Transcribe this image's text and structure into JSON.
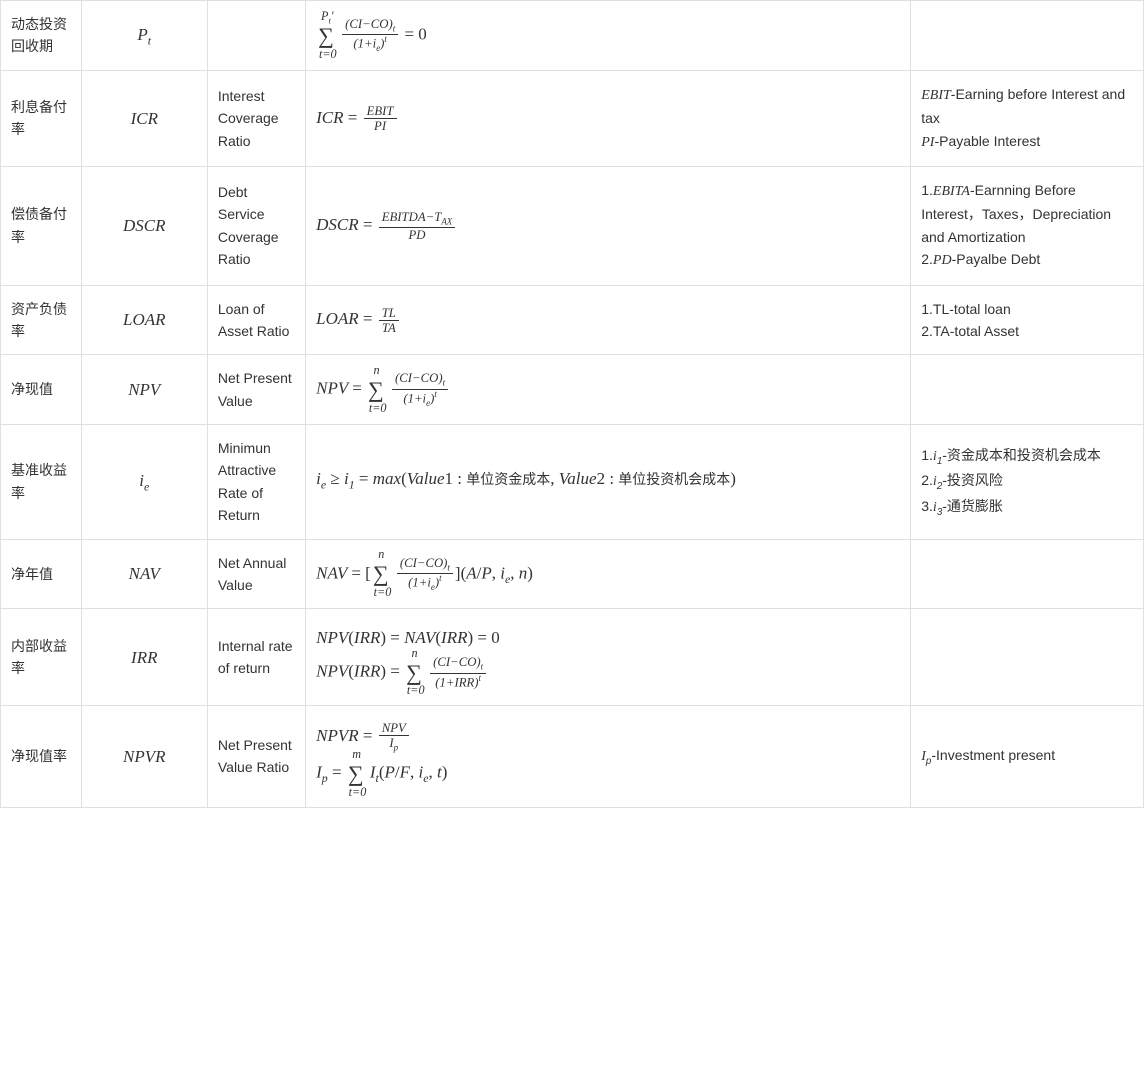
{
  "rows": [
    {
      "name": "动态投资回收期",
      "symbol_html": "<span class='mi'>P</span><span class='sub'>t</span>",
      "english": "",
      "formula_html": "<span class='bigop'>∑<span class='limits-top'>P<span class=\"sub\">t</span>′</span><span class='limits-bot'>t=0</span></span>&nbsp;<span class='frac'><span class='num'>(CI−CO)<span class=\"sub\">t</span></span><span class='den'>(1+i<span class=\"sub\">e</span>)<span class=\"sup\">t</span></span></span> <span class='mn'>= 0</span>",
      "note_html": ""
    },
    {
      "name": "利息备付率",
      "symbol_html": "<span class='mi'>ICR</span>",
      "english": "Interest Coverage Ratio",
      "formula_html": "<span class='mi'>ICR</span> <span class='mn'>=</span> <span class='frac'><span class='num'>EBIT</span><span class='den'>PI</span></span>",
      "note_html": "<span class='mi'>EBIT</span>-Earning before Interest and tax<br><span class='mi'>PI</span>-Payable Interest"
    },
    {
      "name": "偿债备付率",
      "symbol_html": "<span class='mi'>DSCR</span>",
      "english": "Debt Service Coverage Ratio",
      "formula_html": "<span class='mi'>DSCR</span> <span class='mn'>=</span> <span class='frac'><span class='num'>EBITDA−T<span class=\"sub\">AX</span></span><span class='den'>PD</span></span>",
      "note_html": "1.<span class='mi'>EBITA</span>-Earnning Before Interest，Taxes，Depreciation and Amortization<br>2.<span class='mi'>PD</span>-Payalbe Debt"
    },
    {
      "name": "资产负债率",
      "symbol_html": "<span class='mi'>LOAR</span>",
      "english": "Loan of Asset Ratio",
      "formula_html": "<span class='mi'>LOAR</span> <span class='mn'>=</span> <span class='frac'><span class='num'>TL</span><span class='den'>TA</span></span>",
      "note_html": "1.TL-total loan<br>2.TA-total Asset"
    },
    {
      "name": "净现值",
      "symbol_html": "<span class='mi'>NPV</span>",
      "english": "Net Present Value",
      "formula_html": "<span class='mi'>NPV</span> <span class='mn'>=</span> <span class='bigop'>∑<span class='limits-top'>n</span><span class='limits-bot'>t=0</span></span>&nbsp;<span class='frac'><span class='num'>(CI−CO)<span class=\"sub\">t</span></span><span class='den'>(1+i<span class=\"sub\">e</span>)<span class=\"sup\">t</span></span></span>",
      "note_html": ""
    },
    {
      "name": "基准收益率",
      "symbol_html": "<span class='mi'>i</span><span class='sub'>e</span>",
      "english": "Minimun Attractive Rate of Return",
      "formula_html": "<span class='mi'>i</span><span class='sub'>e</span> <span class='mn'>≥</span> <span class='mi'>i</span><span class='sub'>1</span> <span class='mn'>=</span> <span class='mi'>max</span><span class='mn'>(</span><span class='mi'>Value</span><span class='mn'>1 : </span><span class='mtext'>单位资金成本</span><span class='mn'>, </span><span class='mi'>Value</span><span class='mn'>2 : </span><span class='mtext'>单位投资机会成本</span><span class='mn'>)</span>&nbsp;&nbsp;&nbsp;&nbsp;&nbsp;&nbsp;&nbsp;&nbsp;",
      "formula_scroll": true,
      "note_html": "1.<span class='mi'>i</span><span class='sub'>1</span>-资金成本和投资机会成本<br>2.<span class='mi'>i</span><span class='sub'>2</span>-投资风险<br>3.<span class='mi'>i</span><span class='sub'>3</span>-通货膨胀"
    },
    {
      "name": "净年值",
      "symbol_html": "<span class='mi'>NAV</span>",
      "english": "Net Annual Value",
      "formula_html": "<span class='mi'>NAV</span> <span class='mn'>= [</span><span class='bigop'>∑<span class='limits-top'>n</span><span class='limits-bot'>t=0</span></span>&nbsp;<span class='frac'><span class='num'>(CI−CO)<span class=\"sub\">t</span></span><span class='den'>(1+i<span class=\"sub\">e</span>)<span class=\"sup\">t</span></span></span><span class='mn'>](</span><span class='mi'>A</span><span class='mn'>/</span><span class='mi'>P</span><span class='mn'>, </span><span class='mi'>i</span><span class='sub'>e</span><span class='mn'>, </span><span class='mi'>n</span><span class='mn'>)</span>",
      "note_html": ""
    },
    {
      "name": "内部收益率",
      "symbol_html": "<span class='mi'>IRR</span>",
      "english": "Internal rate of return",
      "formula_html": "<span class='mline'><span class='mi'>NPV</span><span class='mn'>(</span><span class='mi'>IRR</span><span class='mn'>) = </span><span class='mi'>NAV</span><span class='mn'>(</span><span class='mi'>IRR</span><span class='mn'>) = 0</span></span><span class='mline'><span class='mi'>NPV</span><span class='mn'>(</span><span class='mi'>IRR</span><span class='mn'>) = </span><span class='bigop'>∑<span class='limits-top'>n</span><span class='limits-bot'>t=0</span></span>&nbsp;<span class='frac'><span class='num'>(CI−CO)<span class=\"sub\">t</span></span><span class='den'>(1+IRR)<span class=\"sup\">t</span></span></span></span>",
      "note_html": ""
    },
    {
      "name": "净现值率",
      "symbol_html": "<span class='mi'>NPVR</span>",
      "english": "Net Present Value Ratio",
      "formula_html": "<span class='mline'><span class='mi'>NPVR</span> <span class='mn'>=</span> <span class='frac'><span class='num'>NPV</span><span class='den'>I<span class=\"sub\">p</span></span></span></span><span class='mline'><span class='mi'>I</span><span class='sub'>p</span> <span class='mn'>=</span> <span class='bigop'>∑<span class='limits-top'>m</span><span class='limits-bot'>t=0</span></span>&nbsp;<span class='mi'>I</span><span class='sub'>t</span><span class='mn'>(</span><span class='mi'>P</span><span class='mn'>/</span><span class='mi'>F</span><span class='mn'>, </span><span class='mi'>i</span><span class='sub'>e</span><span class='mn'>, </span><span class='mi'>t</span><span class='mn'>)</span></span>",
      "note_html": "<span class='mi'>I</span><span class='sub'>p</span>-Investment present"
    }
  ]
}
